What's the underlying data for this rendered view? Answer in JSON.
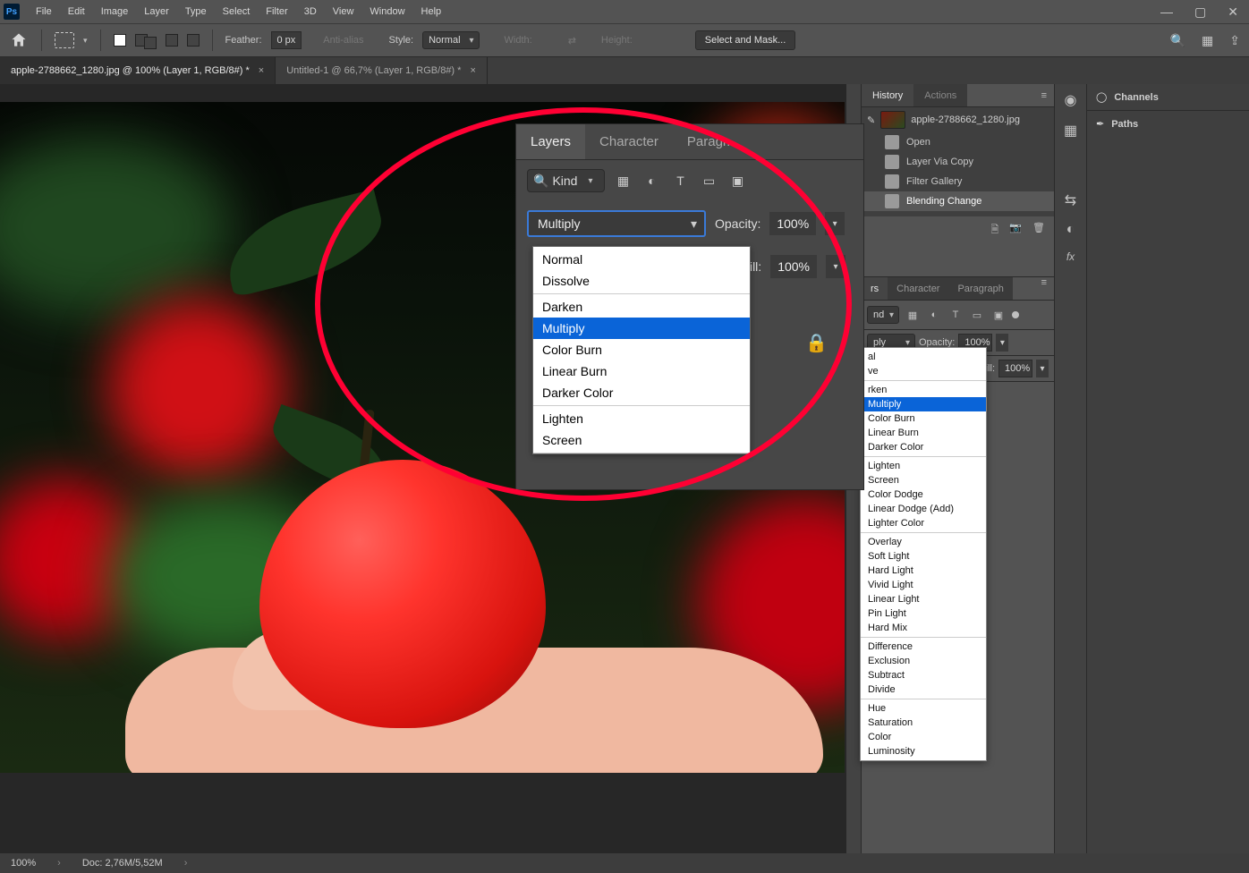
{
  "menubar": [
    "File",
    "Edit",
    "Image",
    "Layer",
    "Type",
    "Select",
    "Filter",
    "3D",
    "View",
    "Window",
    "Help"
  ],
  "options": {
    "feather_label": "Feather:",
    "feather_value": "0 px",
    "antialias": "Anti-alias",
    "style_label": "Style:",
    "style_value": "Normal",
    "width_label": "Width:",
    "height_label": "Height:",
    "select_mask_btn": "Select and Mask..."
  },
  "doc_tabs": [
    "apple-2788662_1280.jpg @ 100% (Layer 1, RGB/8#) *",
    "Untitled-1 @ 66,7% (Layer 1, RGB/8#) *"
  ],
  "panels": {
    "history_tab": "History",
    "actions_tab": "Actions",
    "history_source": "apple-2788662_1280.jpg",
    "history_items": [
      "Open",
      "Layer Via Copy",
      "Filter Gallery",
      "Blending Change"
    ],
    "layers_tab": "Layers",
    "character_tab": "Character",
    "paragraph_tab": "Paragraph",
    "kind_label": "Kind",
    "opacity_label": "Opacity:",
    "opacity_value": "100%",
    "fill_label": "Fill:",
    "fill_value": "100%",
    "blend_value": "Multiply",
    "blend_modes": {
      "g1": [
        "Normal",
        "Dissolve"
      ],
      "g2": [
        "Darken",
        "Multiply",
        "Color Burn",
        "Linear Burn",
        "Darker Color"
      ],
      "g3": [
        "Lighten",
        "Screen",
        "Color Dodge",
        "Linear Dodge (Add)",
        "Lighter Color"
      ],
      "g4": [
        "Overlay",
        "Soft Light",
        "Hard Light",
        "Vivid Light",
        "Linear Light",
        "Pin Light",
        "Hard Mix"
      ],
      "g5": [
        "Difference",
        "Exclusion",
        "Subtract",
        "Divide"
      ],
      "g6": [
        "Hue",
        "Saturation",
        "Color",
        "Luminosity"
      ]
    }
  },
  "side_panels": {
    "channels": "Channels",
    "paths": "Paths"
  },
  "zoom_panel": {
    "tabs": [
      "Layers",
      "Character",
      "Paragr..."
    ],
    "kind": "Kind",
    "blend": "Multiply",
    "opacity_label": "Opacity:",
    "opacity_value": "100%",
    "fill_label": "Fill:",
    "fill_value": "100%",
    "dd_visible": {
      "g1": [
        "Normal",
        "Dissolve"
      ],
      "g2": [
        "Darken",
        "Multiply",
        "Color Burn",
        "Linear Burn",
        "Darker Color"
      ],
      "g3": [
        "Lighten",
        "Screen"
      ]
    }
  },
  "status": {
    "zoom": "100%",
    "doc": "Doc: 2,76M/5,52M"
  },
  "small_layers": {
    "layers_cut": "rs",
    "blend_cut": "ply",
    "kind_cut": "nd",
    "dd_visible_cut": {
      "g0": [
        "al",
        "ve"
      ],
      "g1": [
        "rken"
      ]
    }
  }
}
